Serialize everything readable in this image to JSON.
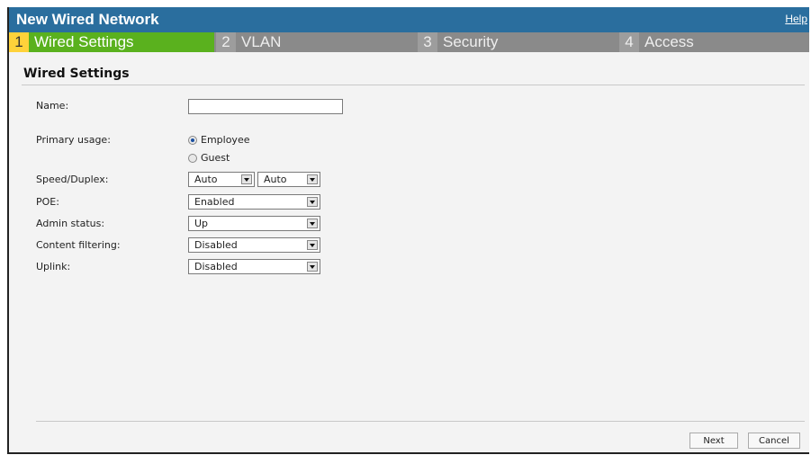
{
  "window": {
    "title": "New Wired Network",
    "help_label": "Help"
  },
  "tabs": [
    {
      "num": "1",
      "label": "Wired Settings"
    },
    {
      "num": "2",
      "label": "VLAN"
    },
    {
      "num": "3",
      "label": "Security"
    },
    {
      "num": "4",
      "label": "Access"
    }
  ],
  "section": {
    "title": "Wired Settings"
  },
  "form": {
    "name_label": "Name:",
    "name_value": "",
    "primary_usage_label": "Primary usage:",
    "usage_options": [
      "Employee",
      "Guest"
    ],
    "usage_selected": "Employee",
    "speed_duplex_label": "Speed/Duplex:",
    "speed_value": "Auto",
    "duplex_value": "Auto",
    "poe_label": "POE:",
    "poe_value": "Enabled",
    "admin_status_label": "Admin status:",
    "admin_status_value": "Up",
    "content_filtering_label": "Content filtering:",
    "content_filtering_value": "Disabled",
    "uplink_label": "Uplink:",
    "uplink_value": "Disabled"
  },
  "buttons": {
    "next": "Next",
    "cancel": "Cancel"
  },
  "colors": {
    "titlebar": "#2a6e9e",
    "active_tab": "#5ab11e",
    "active_num": "#ffd23a",
    "inactive_tab": "#8a8a8a"
  }
}
